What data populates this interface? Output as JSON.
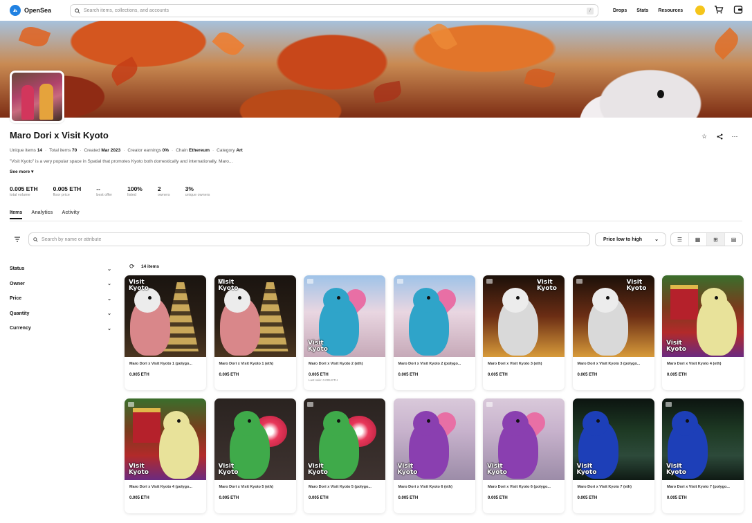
{
  "nav": {
    "brand": "OpenSea",
    "search_placeholder": "Search items, collections, and accounts",
    "search_shortcut": "/",
    "links": [
      "Drops",
      "Stats",
      "Resources"
    ]
  },
  "collection": {
    "title": "Maro Dori x Visit Kyoto",
    "meta": [
      {
        "label": "Unique items",
        "value": "14"
      },
      {
        "label": "Total items",
        "value": "70"
      },
      {
        "label": "Created",
        "value": "Mar 2023"
      },
      {
        "label": "Creator earnings",
        "value": "0%"
      },
      {
        "label": "Chain",
        "value": "Ethereum"
      },
      {
        "label": "Category",
        "value": "Art"
      }
    ],
    "description": "\"Visit Kyoto\" is a very popular space in Spatial that promotes Kyoto both domestically and internationally. Maro...",
    "see_more": "See more",
    "stats": [
      {
        "value": "0.005 ETH",
        "label": "total volume"
      },
      {
        "value": "0.005 ETH",
        "label": "floor price"
      },
      {
        "value": "--",
        "label": "best offer"
      },
      {
        "value": "100%",
        "label": "listed"
      },
      {
        "value": "2",
        "label": "owners"
      },
      {
        "value": "3%",
        "label": "unique owners"
      }
    ]
  },
  "tabs": [
    "Items",
    "Analytics",
    "Activity"
  ],
  "filters": {
    "search_placeholder": "Search by name or attribute",
    "sort": "Price low to high",
    "sidebar": [
      "Status",
      "Owner",
      "Price",
      "Quantity",
      "Currency"
    ],
    "result_count": "14 items"
  },
  "items": [
    {
      "name": "Maro Dori x Visit Kyoto 1 (polygo...",
      "price": "0.005 ETH",
      "last_sale": "",
      "scene": "pagoda",
      "bird": "#d9878a",
      "label": "Visit Kyoto"
    },
    {
      "name": "Maro Dori x Visit Kyoto 1 (eth)",
      "price": "0.005 ETH",
      "last_sale": "",
      "scene": "pagoda",
      "bird": "#d9878a",
      "label": "Visit Kyoto"
    },
    {
      "name": "Maro Dori x Visit Kyoto 2 (eth)",
      "price": "0.005 ETH",
      "last_sale": "Last sale: 0.005 ETH",
      "scene": "blossom",
      "bird": "#2fa4c9",
      "label": "Visit Kyoto"
    },
    {
      "name": "Maro Dori x Visit Kyoto 2 (polygo...",
      "price": "0.005 ETH",
      "last_sale": "",
      "scene": "blossom",
      "bird": "#2fa4c9",
      "label": ""
    },
    {
      "name": "Maro Dori x Visit Kyoto 3 (eth)",
      "price": "0.005 ETH",
      "last_sale": "",
      "scene": "street",
      "bird": "#d9d9d9",
      "label": "Visit Kyoto"
    },
    {
      "name": "Maro Dori x Visit Kyoto 3 (polygo...",
      "price": "0.005 ETH",
      "last_sale": "",
      "scene": "street",
      "bird": "#d9d9d9",
      "label": "Visit Kyoto"
    },
    {
      "name": "Maro Dori x Visit Kyoto 4 (eth)",
      "price": "0.005 ETH",
      "last_sale": "",
      "scene": "festival",
      "bird": "#e8e29a",
      "label": "Visit Kyoto"
    },
    {
      "name": "Maro Dori x Visit Kyoto 4 (polygo...",
      "price": "0.005 ETH",
      "last_sale": "",
      "scene": "festival",
      "bird": "#e8e29a",
      "label": "Visit Kyoto"
    },
    {
      "name": "Maro Dori x Visit Kyoto 5 (eth)",
      "price": "0.005 ETH",
      "last_sale": "",
      "scene": "lantern",
      "bird": "#3faa4a",
      "label": "Visit Kyoto"
    },
    {
      "name": "Maro Dori x Visit Kyoto 5 (polygo...",
      "price": "0.005 ETH",
      "last_sale": "",
      "scene": "lantern",
      "bird": "#3faa4a",
      "label": "Visit Kyoto"
    },
    {
      "name": "Maro Dori x Visit Kyoto 6 (eth)",
      "price": "0.005 ETH",
      "last_sale": "",
      "scene": "purple",
      "bird": "#8a3fb0",
      "label": "Visit Kyoto"
    },
    {
      "name": "Maro Dori x Visit Kyoto 6 (polygo...",
      "price": "0.005 ETH",
      "last_sale": "",
      "scene": "purple",
      "bird": "#8a3fb0",
      "label": "Visit Kyoto"
    },
    {
      "name": "Maro Dori x Visit Kyoto 7 (eth)",
      "price": "0.005 ETH",
      "last_sale": "",
      "scene": "peacock",
      "bird": "#1d3fb8",
      "label": "Visit Kyoto"
    },
    {
      "name": "Maro Dori x Visit Kyoto 7 (polygo...",
      "price": "0.005 ETH",
      "last_sale": "",
      "scene": "peacock",
      "bird": "#1d3fb8",
      "label": "Visit Kyoto"
    }
  ],
  "colors": {
    "brand": "#2081e2",
    "wallet": "#f5c51b"
  }
}
